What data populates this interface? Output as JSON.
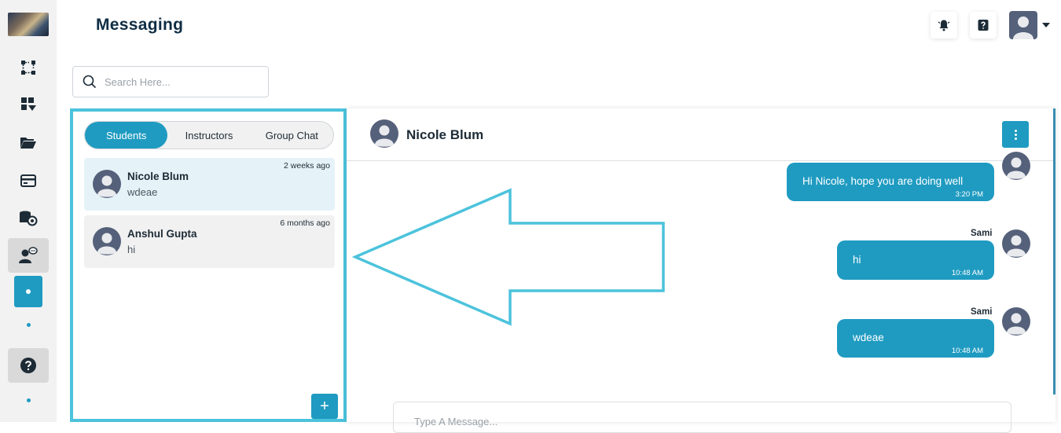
{
  "header": {
    "title": "Messaging"
  },
  "search": {
    "placeholder": "Search Here..."
  },
  "tabs": [
    {
      "label": "Students",
      "active": true
    },
    {
      "label": "Instructors",
      "active": false
    },
    {
      "label": "Group Chat",
      "active": false
    }
  ],
  "contacts": [
    {
      "name": "Nicole Blum",
      "last_message": "wdeae",
      "time": "2 weeks ago",
      "selected": true
    },
    {
      "name": "Anshul Gupta",
      "last_message": "hi",
      "time": "6 months ago",
      "selected": false
    }
  ],
  "add_button": {
    "label": "+"
  },
  "chat": {
    "contact_name": "Nicole Blum",
    "messages": [
      {
        "sender": "",
        "text": "Hi Nicole, hope you are doing well",
        "time": "3:20 PM"
      },
      {
        "sender": "Sami",
        "text": "hi",
        "time": "10:48 AM"
      },
      {
        "sender": "Sami",
        "text": "wdeae",
        "time": "10:48 AM"
      }
    ]
  },
  "composer": {
    "placeholder": "Type A Message..."
  },
  "colors": {
    "accent": "#1f9bc1",
    "highlight_border": "#4cc3dc",
    "rail_bg": "#f2f2f2",
    "title": "#0f2d44"
  },
  "icons": {
    "rail": [
      "app-logo",
      "workflow-icon",
      "dashboard-icon",
      "folder-open-icon",
      "card-icon",
      "database-settings-icon",
      "user-chat-icon",
      "dot-icon",
      "help-icon"
    ],
    "header": [
      "bell-icon",
      "question-icon",
      "user-avatar"
    ]
  }
}
